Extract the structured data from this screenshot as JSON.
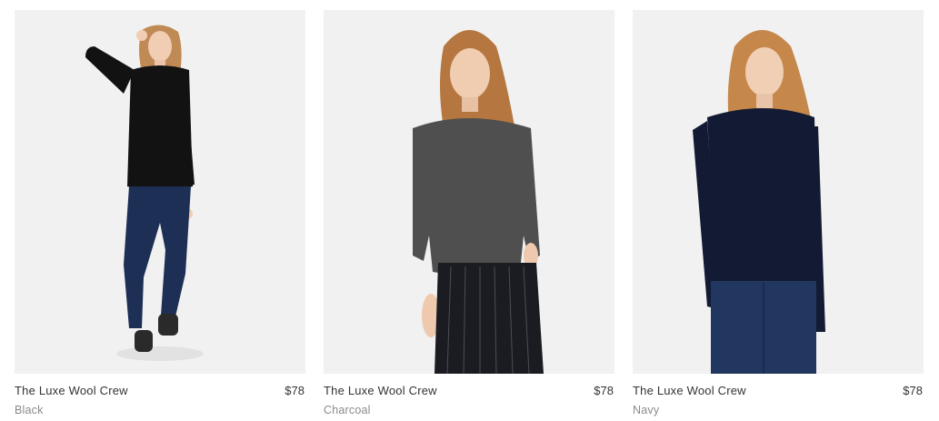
{
  "products": [
    {
      "name": "The Luxe Wool Crew",
      "price": "$78",
      "color_name": "Black",
      "sweater_color": "#121212",
      "pants_color": "#1d2f55"
    },
    {
      "name": "The Luxe Wool Crew",
      "price": "$78",
      "color_name": "Charcoal",
      "sweater_color": "#4f4f4f",
      "pants_color": "#1b1c22"
    },
    {
      "name": "The Luxe Wool Crew",
      "price": "$78",
      "color_name": "Navy",
      "sweater_color": "#131a33",
      "pants_color": "#22375f"
    }
  ]
}
